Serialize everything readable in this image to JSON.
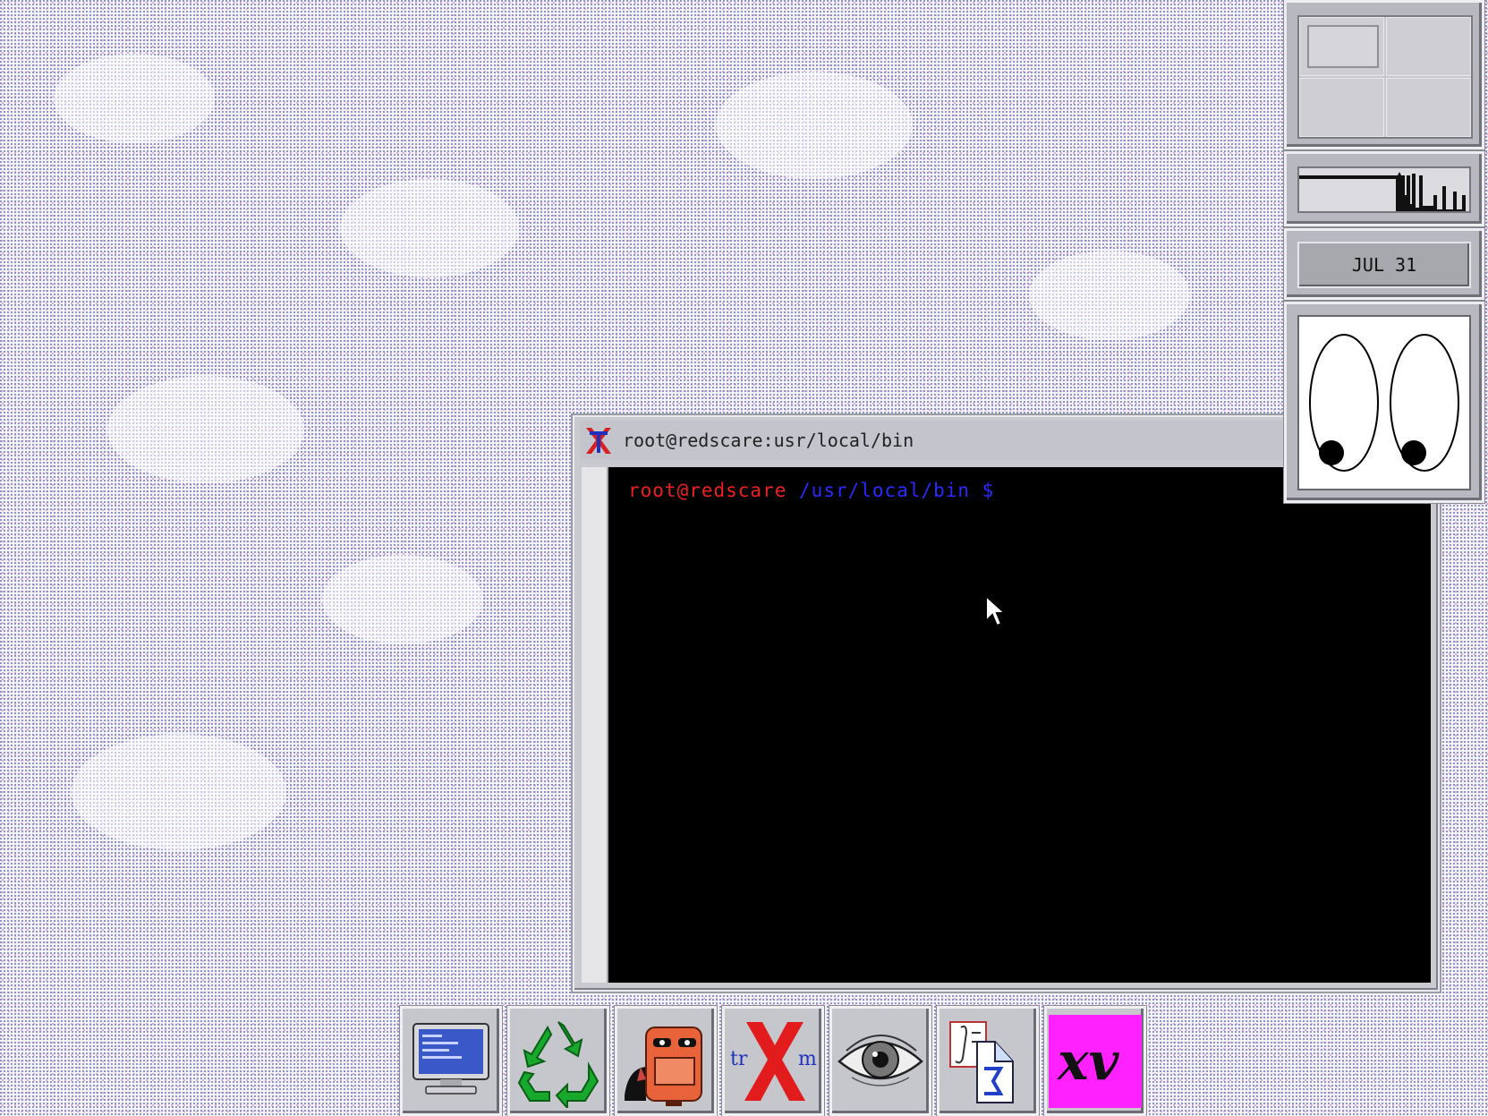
{
  "terminal": {
    "title": "root@redscare:usr/local/bin",
    "prompt_user": "root@redscare",
    "prompt_path": "/usr/local/bin $"
  },
  "dock": {
    "date_label": "JUL 31",
    "pager_desktops": 4,
    "pager_active": 1
  },
  "launcher": {
    "items": [
      {
        "name": "terminal-monitor"
      },
      {
        "name": "recycle"
      },
      {
        "name": "mail"
      },
      {
        "name": "xterm"
      },
      {
        "name": "xeyes"
      },
      {
        "name": "calculator"
      },
      {
        "name": "xv"
      }
    ],
    "trm_left": "tr",
    "trm_right": "m",
    "xv_label": "xv"
  },
  "colors": {
    "prompt_user": "#ee2020",
    "prompt_path": "#2a2aff",
    "xv_bg": "#ff22ff",
    "mailbox": "#e8623a",
    "recycle": "#17a82c"
  }
}
